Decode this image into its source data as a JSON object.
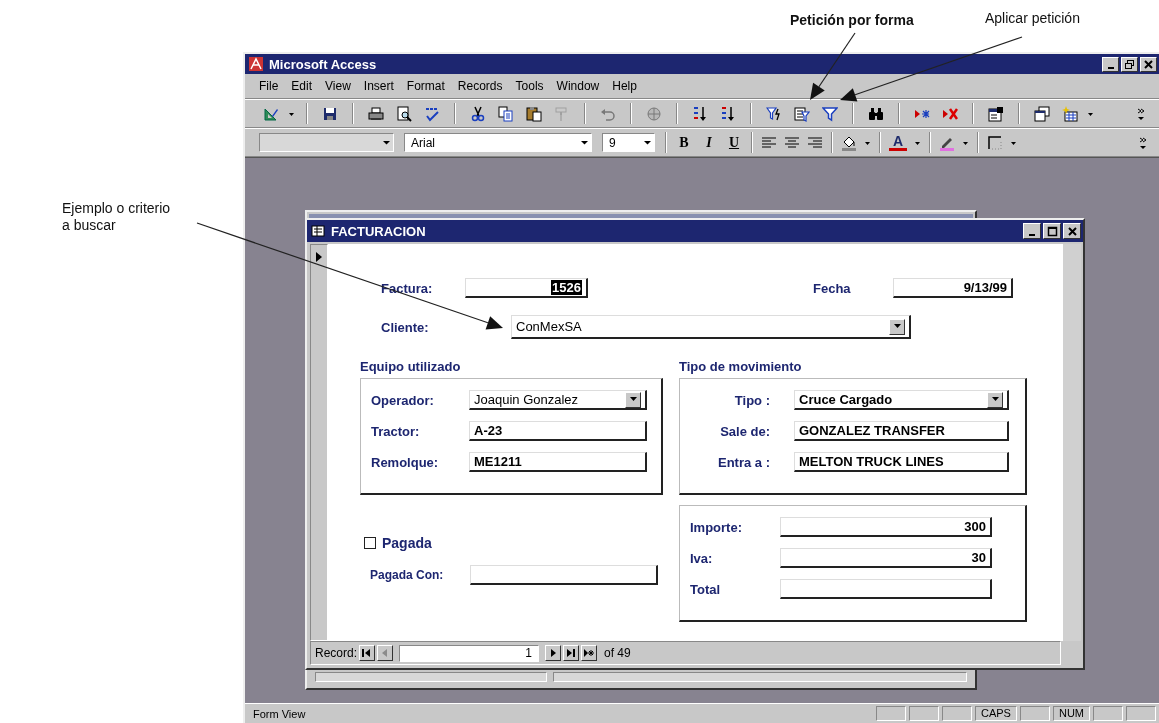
{
  "callouts": [
    {
      "text": "Petición por forma",
      "bold": true
    },
    {
      "text": "Aplicar petición",
      "bold": false
    },
    {
      "text": "Ejemplo o criterio a buscar",
      "bold": false
    }
  ],
  "window": {
    "title": "Microsoft Access"
  },
  "menu": [
    "File",
    "Edit",
    "View",
    "Insert",
    "Format",
    "Records",
    "Tools",
    "Window",
    "Help"
  ],
  "toolbar_1": [
    [
      {
        "kind": "view",
        "disabled": false
      },
      {
        "kind": "caret",
        "disabled": false
      }
    ],
    [
      {
        "kind": "save",
        "disabled": false
      }
    ],
    [
      {
        "kind": "print",
        "disabled": false
      },
      {
        "kind": "preview",
        "disabled": false
      },
      {
        "kind": "spelling",
        "disabled": false
      }
    ],
    [
      {
        "kind": "cut",
        "disabled": false
      },
      {
        "kind": "copy",
        "disabled": false
      },
      {
        "kind": "paste",
        "disabled": false
      },
      {
        "kind": "painter",
        "disabled": true
      }
    ],
    [
      {
        "kind": "undo",
        "disabled": true
      }
    ],
    [
      {
        "kind": "hyperlink",
        "disabled": true
      }
    ],
    [
      {
        "kind": "sort_asc",
        "disabled": false
      },
      {
        "kind": "sort_desc",
        "disabled": false
      }
    ],
    [
      {
        "kind": "filter_sel",
        "disabled": false
      },
      {
        "kind": "filter_form",
        "disabled": false
      },
      {
        "kind": "filter_apply",
        "disabled": false
      }
    ],
    [
      {
        "kind": "find",
        "disabled": false
      }
    ],
    [
      {
        "kind": "new_record",
        "disabled": false
      },
      {
        "kind": "delete_record",
        "disabled": false
      }
    ],
    [
      {
        "kind": "properties",
        "disabled": false
      }
    ],
    [
      {
        "kind": "database_window",
        "disabled": false
      },
      {
        "kind": "new_object",
        "disabled": false
      },
      {
        "kind": "caret",
        "disabled": false
      }
    ],
    [
      {
        "kind": "chevron",
        "disabled": false
      }
    ]
  ],
  "toolbar_2": {
    "font": "Arial",
    "size": "9",
    "groups": [
      [
        {
          "kind": "bold",
          "label": "B"
        },
        {
          "kind": "italic",
          "label": "I"
        },
        {
          "kind": "underline",
          "label": "U"
        }
      ],
      [
        {
          "kind": "align_left"
        },
        {
          "kind": "align_center"
        },
        {
          "kind": "align_right"
        }
      ],
      [
        {
          "kind": "fill_color"
        },
        {
          "kind": "caret"
        }
      ],
      [
        {
          "kind": "font_color",
          "label": "A"
        },
        {
          "kind": "caret"
        }
      ],
      [
        {
          "kind": "line_color"
        },
        {
          "kind": "caret"
        }
      ],
      [
        {
          "kind": "border"
        },
        {
          "kind": "caret"
        }
      ],
      [
        {
          "kind": "chevron"
        }
      ]
    ]
  },
  "form": {
    "title": "FACTURACION",
    "factura": {
      "label": "Factura:",
      "value": "1526",
      "selected": true
    },
    "fecha": {
      "label": "Fecha",
      "value": "9/13/99"
    },
    "cliente": {
      "label": "Cliente:",
      "value": "ConMexSA"
    },
    "groups": [
      {
        "title": "Equipo utilizado",
        "rows": [
          {
            "label": "Operador:",
            "value": "Joaquin Gonzalez",
            "kind": "combo"
          },
          {
            "label": "Tractor:",
            "value": "A-23",
            "kind": "text"
          },
          {
            "label": "Remolque:",
            "value": "ME1211",
            "kind": "text"
          }
        ]
      },
      {
        "title": "Tipo de movimiento",
        "rows": [
          {
            "label": "Tipo :",
            "value": "Cruce Cargado",
            "kind": "combo"
          },
          {
            "label": "Sale de:",
            "value": "GONZALEZ TRANSFER",
            "kind": "text"
          },
          {
            "label": "Entra a :",
            "value": "MELTON TRUCK LINES",
            "kind": "text"
          }
        ]
      }
    ],
    "pagada": {
      "label": "Pagada",
      "checked": false
    },
    "pagada_con": {
      "label": "Pagada Con:"
    },
    "totals": [
      {
        "label": "Importe:",
        "value": "300"
      },
      {
        "label": "Iva:",
        "value": "30"
      },
      {
        "label": "Total"
      }
    ],
    "navigation": {
      "label": "Record:",
      "current": "1",
      "count": "of 49",
      "buttons": [
        {
          "kind": "first",
          "disabled": false
        },
        {
          "kind": "prev",
          "disabled": true
        },
        {
          "kind": "next",
          "disabled": false
        },
        {
          "kind": "last",
          "disabled": false
        },
        {
          "kind": "new",
          "disabled": false
        }
      ]
    }
  },
  "status_bar": {
    "mode": "Form View",
    "indicators": [
      "CAPS",
      "NUM"
    ]
  }
}
